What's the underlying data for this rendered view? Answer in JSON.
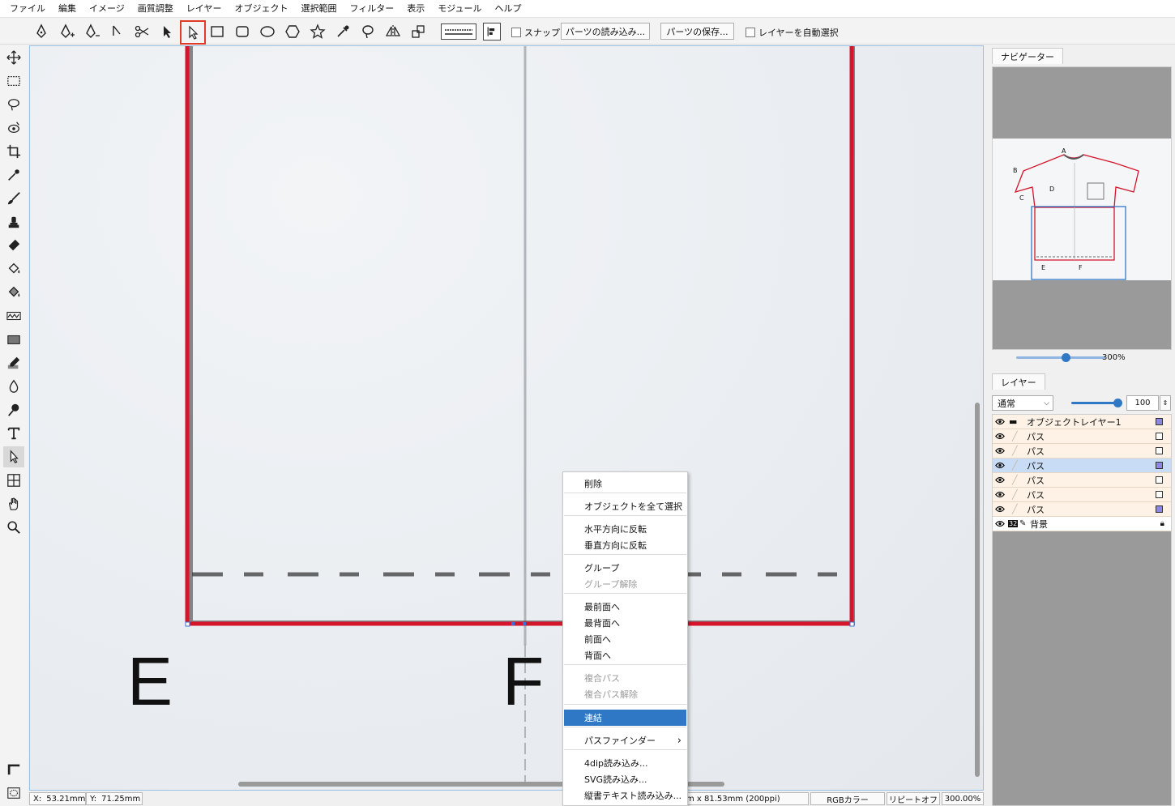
{
  "menu": [
    "ファイル",
    "編集",
    "イメージ",
    "画質調整",
    "レイヤー",
    "オブジェクト",
    "選択範囲",
    "フィルター",
    "表示",
    "モジュール",
    "ヘルプ"
  ],
  "toolbar": {
    "snap_label": "スナップ",
    "load_parts": "パーツの読み込み...",
    "save_parts": "パーツの保存...",
    "auto_select_layer": "レイヤーを自動選択"
  },
  "canvas": {
    "label_e": "E",
    "label_f": "F",
    "colors": {
      "path": "#d4152c",
      "selection": "#3a6fd8"
    }
  },
  "status": {
    "x_label": "X:",
    "x_value": "53.21mm",
    "y_label": "Y:",
    "y_value": "71.25mm",
    "size": "m x 81.53mm (200ppi)",
    "color_mode": "RGBカラー",
    "repeat": "リピートオフ",
    "zoom": "300.00%"
  },
  "navigator": {
    "tab": "ナビゲーター",
    "zoom": "300%",
    "zoom_fraction": 0.55,
    "labels": [
      "A",
      "B",
      "C",
      "D",
      "E",
      "F"
    ]
  },
  "layers": {
    "tab": "レイヤー",
    "blend_mode": "通常",
    "opacity": "100",
    "opacity_fraction": 1.0,
    "items": [
      {
        "name": "オブジェクトレイヤー1",
        "filled": true,
        "selected": false
      },
      {
        "name": "パス",
        "filled": false,
        "selected": false
      },
      {
        "name": "パス",
        "filled": false,
        "selected": false
      },
      {
        "name": "パス",
        "filled": true,
        "selected": true
      },
      {
        "name": "パス",
        "filled": false,
        "selected": false
      },
      {
        "name": "パス",
        "filled": false,
        "selected": false
      },
      {
        "name": "パス",
        "filled": true,
        "selected": false
      }
    ],
    "background": {
      "badge": "32",
      "name": "背景"
    }
  },
  "context_menu": {
    "items": [
      {
        "label": "削除",
        "disabled": false
      },
      {
        "label": "オブジェクトを全て選択",
        "disabled": false
      },
      {
        "label": "水平方向に反転",
        "disabled": false
      },
      {
        "label": "垂直方向に反転",
        "disabled": false
      },
      {
        "label": "グループ",
        "disabled": false
      },
      {
        "label": "グループ解除",
        "disabled": true
      },
      {
        "label": "最前面へ",
        "disabled": false
      },
      {
        "label": "最背面へ",
        "disabled": false
      },
      {
        "label": "前面へ",
        "disabled": false
      },
      {
        "label": "背面へ",
        "disabled": false
      },
      {
        "label": "複合パス",
        "disabled": true
      },
      {
        "label": "複合パス解除",
        "disabled": true
      },
      {
        "label": "連結",
        "disabled": false,
        "highlighted": true
      },
      {
        "label": "パスファインダー",
        "disabled": false,
        "submenu": true
      },
      {
        "label": "4dip読み込み...",
        "disabled": false
      },
      {
        "label": "SVG読み込み...",
        "disabled": false
      },
      {
        "label": "縦書テキスト読み込み...",
        "disabled": false
      }
    ]
  }
}
